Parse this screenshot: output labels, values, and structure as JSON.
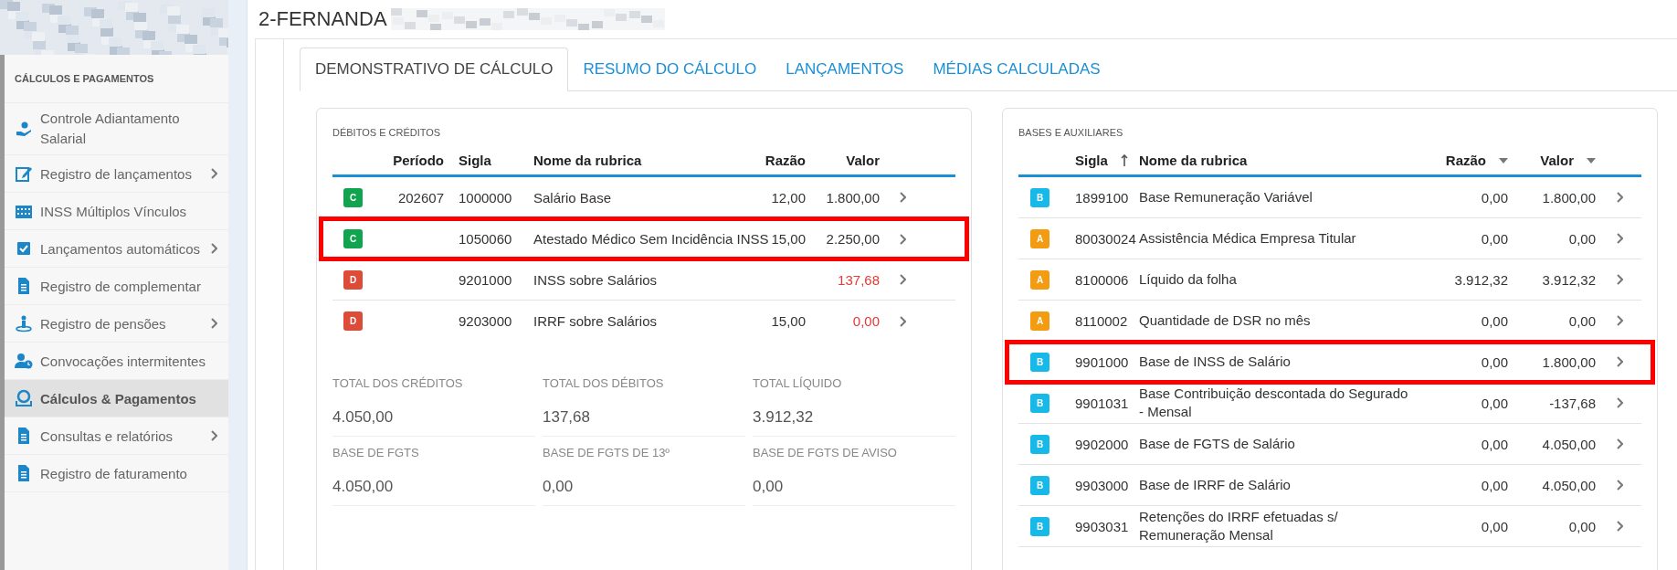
{
  "sidebar": {
    "heading": "CÁLCULOS E PAGAMENTOS",
    "items": [
      {
        "label": "Controle Adiantamento Salarial",
        "has_submenu": false,
        "selected": false
      },
      {
        "label": "Registro de lançamentos",
        "has_submenu": true,
        "selected": false
      },
      {
        "label": "INSS Múltiplos Vínculos",
        "has_submenu": false,
        "selected": false
      },
      {
        "label": "Lançamentos automáticos",
        "has_submenu": true,
        "selected": false
      },
      {
        "label": "Registro de complementar",
        "has_submenu": false,
        "selected": false
      },
      {
        "label": "Registro de pensões",
        "has_submenu": true,
        "selected": false
      },
      {
        "label": "Convocações intermitentes",
        "has_submenu": false,
        "selected": false
      },
      {
        "label": "Cálculos & Pagamentos",
        "has_submenu": false,
        "selected": true
      },
      {
        "label": "Consultas e relatórios",
        "has_submenu": true,
        "selected": false
      },
      {
        "label": "Registro de faturamento",
        "has_submenu": false,
        "selected": false
      }
    ]
  },
  "header": {
    "title": "2-FERNANDA"
  },
  "tabs": [
    {
      "label": "DEMONSTRATIVO DE CÁLCULO",
      "selected": true
    },
    {
      "label": "RESUMO DO CÁLCULO",
      "selected": false
    },
    {
      "label": "LANÇAMENTOS",
      "selected": false
    },
    {
      "label": "MÉDIAS CALCULADAS",
      "selected": false
    }
  ],
  "debits_credits": {
    "title": "DÉBITOS E CRÉDITOS",
    "columns": [
      "Período",
      "Sigla",
      "Nome da rubrica",
      "Razão",
      "Valor"
    ],
    "rows": [
      {
        "badge": "C",
        "color": "#10a44f",
        "kind": "credit",
        "periodo": "202607",
        "sigla": "1000000",
        "nome": "Salário Base",
        "razao": "12,00",
        "valor": "1.800,00",
        "highlighted": false
      },
      {
        "badge": "C",
        "color": "#10a44f",
        "kind": "credit",
        "sigla": "1050060",
        "nome": "Atestado Médico Sem Incidência INSS",
        "razao": "15,00",
        "valor": "2.250,00",
        "highlighted": true
      },
      {
        "badge": "D",
        "color": "#dd4b39",
        "kind": "debit",
        "sigla": "9201000",
        "nome": "INSS sobre Salários",
        "valor": "137,68",
        "highlighted": false
      },
      {
        "badge": "D",
        "color": "#dd4b39",
        "kind": "debit",
        "sigla": "9203000",
        "nome": "IRRF sobre Salários",
        "razao": "15,00",
        "valor": "0,00",
        "highlighted": false
      }
    ],
    "totals": [
      {
        "label": "TOTAL DOS CRÉDITOS",
        "value": "4.050,00"
      },
      {
        "label": "TOTAL DOS DÉBITOS",
        "value": "137,68"
      },
      {
        "label": "TOTAL LÍQUIDO",
        "value": "3.912,32"
      },
      {
        "label": "BASE DE FGTS",
        "value": "4.050,00"
      },
      {
        "label": "BASE DE FGTS DE 13º",
        "value": "0,00"
      },
      {
        "label": "BASE DE FGTS DE AVISO",
        "value": "0,00"
      }
    ]
  },
  "bases": {
    "title": "BASES E AUXILIARES",
    "columns": [
      {
        "label": "Sigla",
        "sorted_ascending": true,
        "has_menu": false
      },
      {
        "label": "Nome da rubrica",
        "sorted_ascending": false,
        "has_menu": false
      },
      {
        "label": "Razão",
        "sorted_ascending": false,
        "has_menu": true
      },
      {
        "label": "Valor",
        "sorted_ascending": false,
        "has_menu": true
      }
    ],
    "rows": [
      {
        "badge": "B",
        "color": "#17b9e8",
        "sigla": "1899100",
        "nome": "Base Remuneração Variável",
        "razao": "0,00",
        "valor": "1.800,00",
        "highlighted": false
      },
      {
        "badge": "A",
        "color": "#f39c12",
        "sigla": "80030024",
        "nome": "Assistência Médica Empresa Titular",
        "razao": "0,00",
        "valor": "0,00",
        "highlighted": false
      },
      {
        "badge": "A",
        "color": "#f39c12",
        "sigla": "8100006",
        "nome": "Líquido da folha",
        "razao": "3.912,32",
        "valor": "3.912,32",
        "highlighted": false
      },
      {
        "badge": "A",
        "color": "#f39c12",
        "sigla": "8110002",
        "nome": "Quantidade de DSR no mês",
        "razao": "0,00",
        "valor": "0,00",
        "highlighted": false
      },
      {
        "badge": "B",
        "color": "#17b9e8",
        "sigla": "9901000",
        "nome": "Base de INSS de Salário",
        "razao": "0,00",
        "valor": "1.800,00",
        "highlighted": true
      },
      {
        "badge": "B",
        "color": "#17b9e8",
        "sigla": "9901031",
        "nome": "Base Contribuição descontada do Segurado - Mensal",
        "razao": "0,00",
        "valor": "-137,68",
        "highlighted": false
      },
      {
        "badge": "B",
        "color": "#17b9e8",
        "sigla": "9902000",
        "nome": "Base de FGTS de Salário",
        "razao": "0,00",
        "valor": "4.050,00",
        "highlighted": false
      },
      {
        "badge": "B",
        "color": "#17b9e8",
        "sigla": "9903000",
        "nome": "Base de IRRF de Salário",
        "razao": "0,00",
        "valor": "4.050,00",
        "highlighted": false
      },
      {
        "badge": "B",
        "color": "#17b9e8",
        "sigla": "9903031",
        "nome": "Retenções do IRRF efetuadas s/ Remuneração Mensal",
        "razao": "0,00",
        "valor": "0,00",
        "highlighted": false
      }
    ]
  }
}
